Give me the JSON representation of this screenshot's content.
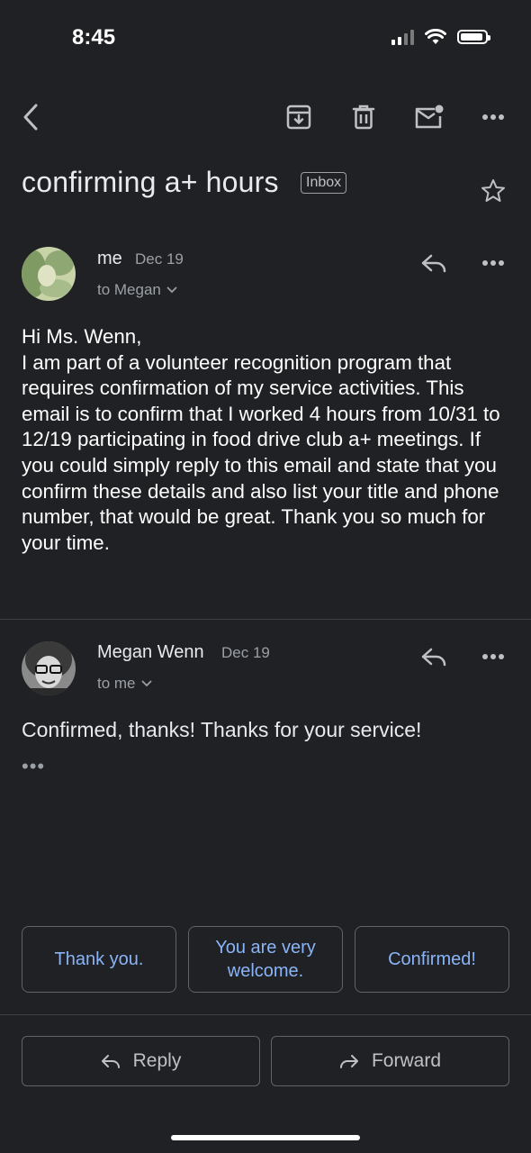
{
  "status_bar": {
    "time": "8:45"
  },
  "toolbar": {
    "back_icon": "chevron-left-icon",
    "archive_icon": "archive-icon",
    "delete_icon": "trash-icon",
    "unread_icon": "mark-unread-icon",
    "more_icon": "more-horiz-icon"
  },
  "subject": {
    "text": "confirming a+ hours",
    "label": "Inbox"
  },
  "messages": [
    {
      "sender": "me",
      "date": "Dec 19",
      "to": "to Megan",
      "body": "Hi Ms. Wenn,\nI am part of a volunteer recognition program that requires confirmation of my service activities. This email is to confirm that I worked 4 hours from 10/31 to 12/19 participating in food drive club a+ meetings. If you could simply reply to this email and state that you confirm these details and also list your title and phone number, that would be great. Thank you so much for your time."
    },
    {
      "sender": "Megan Wenn",
      "date": "Dec 19",
      "to": "to me",
      "body": "Confirmed, thanks! Thanks for your service!",
      "trimmed": "•••"
    }
  ],
  "smart_replies": [
    "Thank you.",
    "You are very welcome.",
    "Confirmed!"
  ],
  "actions": {
    "reply": "Reply",
    "forward": "Forward"
  },
  "colors": {
    "background": "#202124",
    "accent": "#8ab4f8"
  }
}
